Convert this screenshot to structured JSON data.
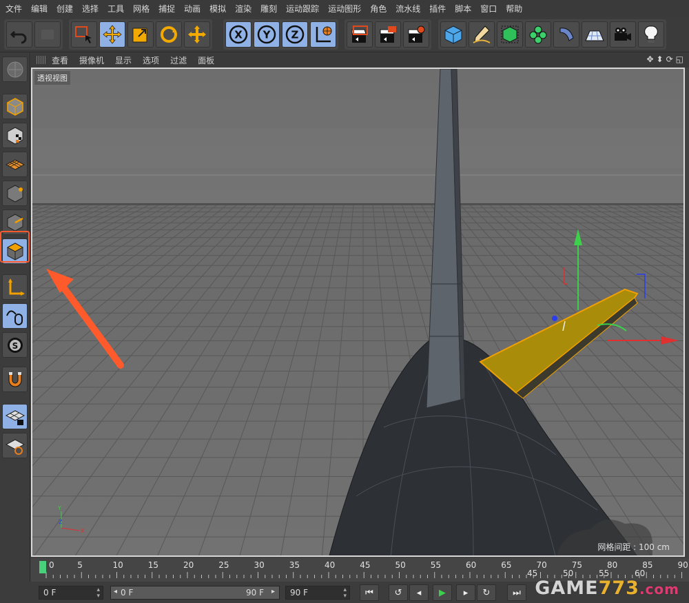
{
  "menu": [
    "文件",
    "编辑",
    "创建",
    "选择",
    "工具",
    "网格",
    "捕捉",
    "动画",
    "模拟",
    "渲染",
    "雕刻",
    "运动跟踪",
    "运动图形",
    "角色",
    "流水线",
    "插件",
    "脚本",
    "窗口",
    "帮助"
  ],
  "toolbar": {
    "undo": "undo-icon",
    "select": "live-selection-icon",
    "move": "move-icon",
    "scale": "scale-icon",
    "rotate": "rotate-icon",
    "recent": "recent-tool-icon",
    "axis_x": "X",
    "axis_y": "Y",
    "axis_z": "Z",
    "coord": "world-coordinate-icon",
    "render_view": "render-view-icon",
    "render_picture": "render-to-picture-viewer-icon",
    "render_settings": "render-settings-icon",
    "cube": "cube-object-icon",
    "pen": "pen-spline-icon",
    "subdivision": "subdivision-surface-icon",
    "cloner": "cloner-icon",
    "deformer": "bend-deformer-icon",
    "floor": "floor-icon",
    "camera": "camera-icon",
    "light": "light-icon"
  },
  "viewport_menu": [
    "查看",
    "摄像机",
    "显示",
    "选项",
    "过滤",
    "面板"
  ],
  "viewport_label": "透视视图",
  "grid_spacing_label": "网格间距 : 100 cm",
  "timeline": {
    "ticks": [
      "0",
      "5",
      "10",
      "15",
      "20",
      "25",
      "30",
      "35",
      "40",
      "45",
      "50",
      "55",
      "60",
      "65",
      "70",
      "75",
      "80",
      "85",
      "90"
    ],
    "overlay_ticks": [
      "45",
      "50",
      "55",
      "60"
    ]
  },
  "bottom": {
    "current_frame": "0 F",
    "range_start": "0 F",
    "range_end": "90 F",
    "max_frame": "90 F"
  },
  "watermark": {
    "part1": "GAME",
    "part2": "773",
    "part3": ".com"
  },
  "colors": {
    "accent": "#8fb1e6",
    "highlight": "#ff5a2c",
    "selected_object": "#b59a10"
  }
}
